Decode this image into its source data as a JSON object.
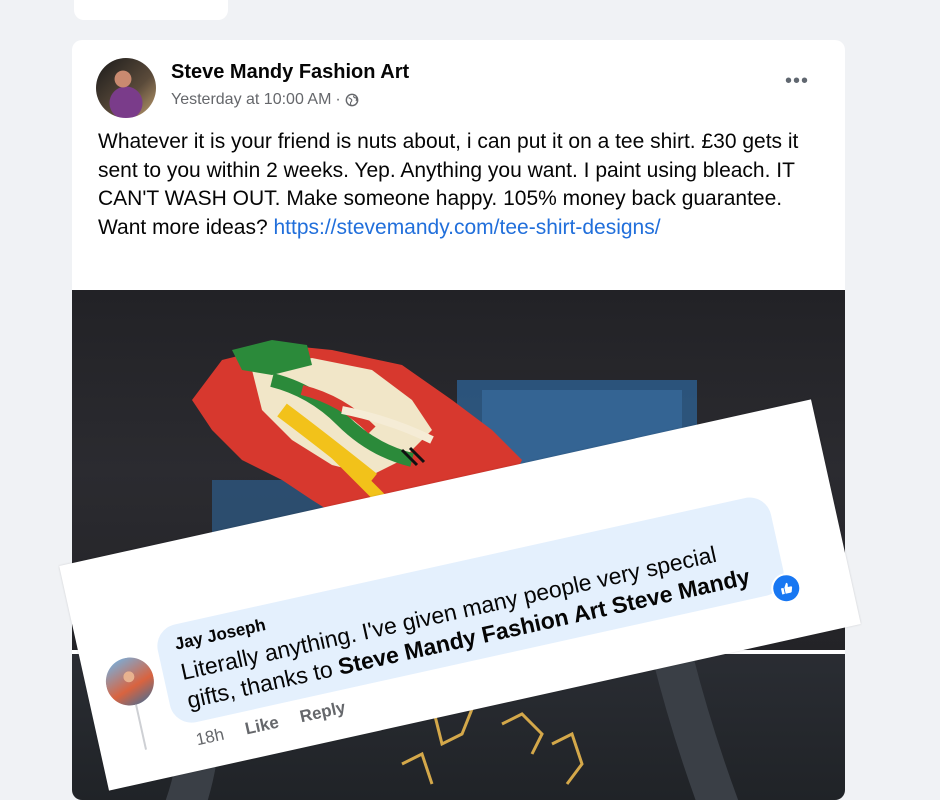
{
  "post": {
    "author": "Steve Mandy Fashion Art",
    "timestamp": "Yesterday at 10:00 AM",
    "separator": "·",
    "privacy_icon": "globe-icon",
    "more_label": "•••",
    "text": "Whatever it is your friend is nuts about, i can put it on a tee shirt.  £30 gets it sent to you within 2 weeks.  Yep.  Anything you want.  I paint using bleach.  IT CAN'T WASH OUT.   Make someone happy.  105% money back guarantee.   Want more ideas? ",
    "link_text": "https://stevemandy.com/tee-shirt-designs/"
  },
  "comment": {
    "author": "Jay Joseph",
    "text": "Literally anything. I've given many people very special gifts, thanks to ",
    "mention": "Steve Mandy Fashion Art Steve Mandy",
    "time": "18h",
    "like_label": "Like",
    "reply_label": "Reply",
    "reaction_icon": "thumbs-up-icon"
  },
  "colors": {
    "page_bg": "#f0f2f5",
    "link": "#216fdb",
    "bubble": "#e4f0fd",
    "like_blue": "#1877f2"
  }
}
